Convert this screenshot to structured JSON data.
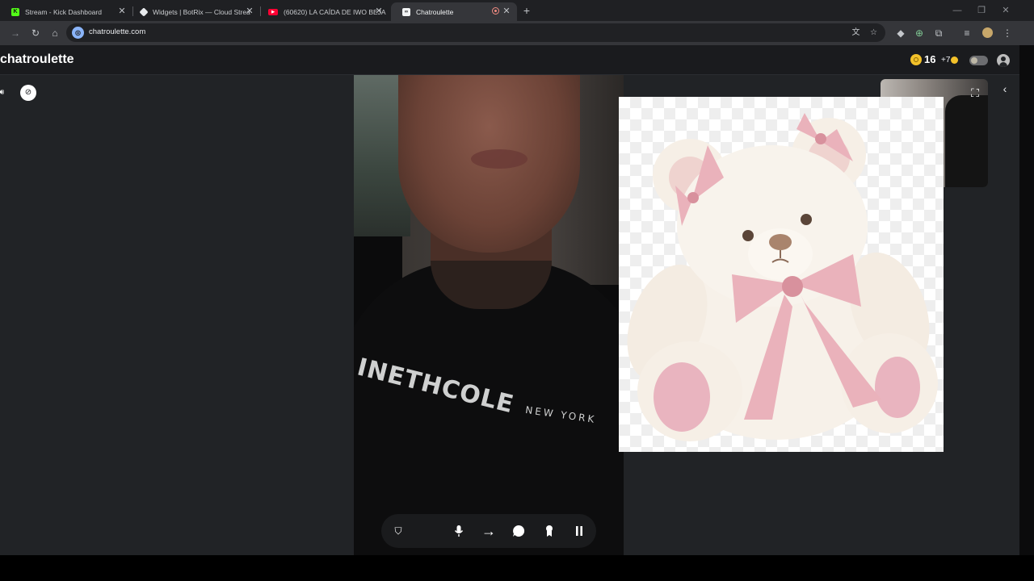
{
  "browser": {
    "tabs": [
      {
        "title": "Stream - Kick Dashboard",
        "favicon": "kick-icon"
      },
      {
        "title": "Widgets | BotRix — Cloud Strea",
        "favicon": "botrix-icon"
      },
      {
        "title": "(60620) LA CAÍDA DE IWO BEJA",
        "favicon": "youtube-icon"
      },
      {
        "title": "Chatroulette",
        "favicon": "chatroulette-icon",
        "active": true
      }
    ],
    "new_tab_label": "+",
    "url": "chatroulette.com"
  },
  "header": {
    "logo": "chatroulette",
    "coins": "16",
    "bonus": "+7"
  },
  "remote_video": {
    "shirt_text_main": "INETHCOLE",
    "shirt_text_city": "NEW YORK"
  },
  "controls": {
    "icons": [
      "shield-icon",
      "microphone-icon",
      "next-arrow-icon",
      "chat-icon",
      "award-icon",
      "pause-icon"
    ]
  },
  "colors": {
    "page_bg": "#212326",
    "header_bg": "#1a1b1e",
    "coin": "#f3c12a",
    "ribbon_pink": "#eab2bb"
  }
}
